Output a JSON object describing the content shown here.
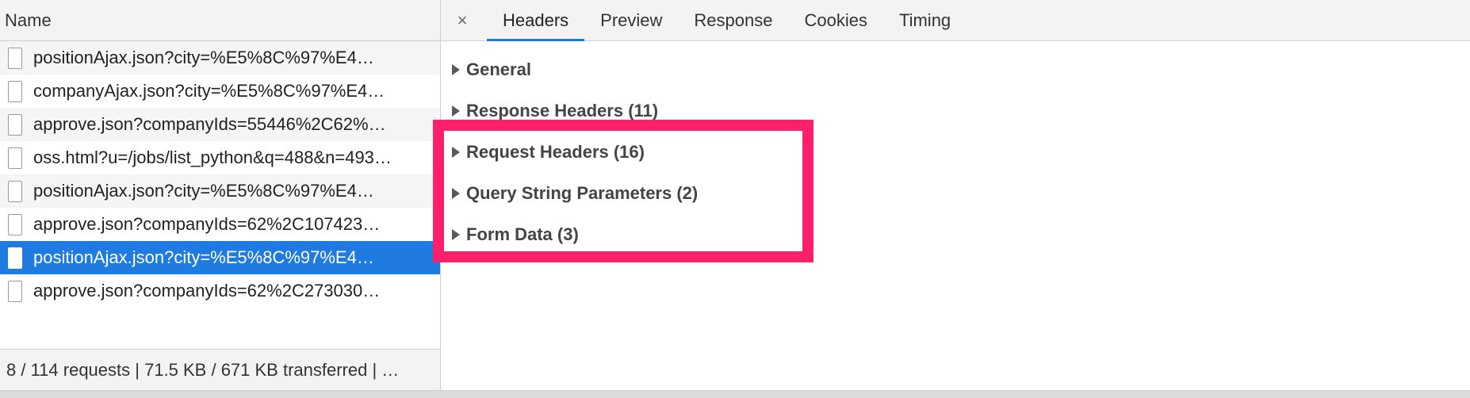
{
  "left_pane": {
    "column_header": "Name",
    "requests": [
      {
        "name": "positionAjax.json?city=%E5%8C%97%E4…",
        "selected": false
      },
      {
        "name": "companyAjax.json?city=%E5%8C%97%E4…",
        "selected": false
      },
      {
        "name": "approve.json?companyIds=55446%2C62%…",
        "selected": false
      },
      {
        "name": "oss.html?u=/jobs/list_python&q=488&n=493…",
        "selected": false
      },
      {
        "name": "positionAjax.json?city=%E5%8C%97%E4…",
        "selected": false
      },
      {
        "name": "approve.json?companyIds=62%2C107423…",
        "selected": false
      },
      {
        "name": "positionAjax.json?city=%E5%8C%97%E4…",
        "selected": true
      },
      {
        "name": "approve.json?companyIds=62%2C273030…",
        "selected": false
      }
    ],
    "status": "8 / 114 requests | 71.5 KB / 671 KB transferred | …"
  },
  "tabs": {
    "close": "×",
    "items": [
      {
        "label": "Headers",
        "active": true
      },
      {
        "label": "Preview",
        "active": false
      },
      {
        "label": "Response",
        "active": false
      },
      {
        "label": "Cookies",
        "active": false
      },
      {
        "label": "Timing",
        "active": false
      }
    ]
  },
  "sections": [
    {
      "label": "General"
    },
    {
      "label": "Response Headers (11)"
    },
    {
      "label": "Request Headers (16)"
    },
    {
      "label": "Query String Parameters (2)"
    },
    {
      "label": "Form Data (3)"
    }
  ],
  "colors": {
    "selection": "#1f7be0",
    "highlight": "#ff1f6a"
  }
}
